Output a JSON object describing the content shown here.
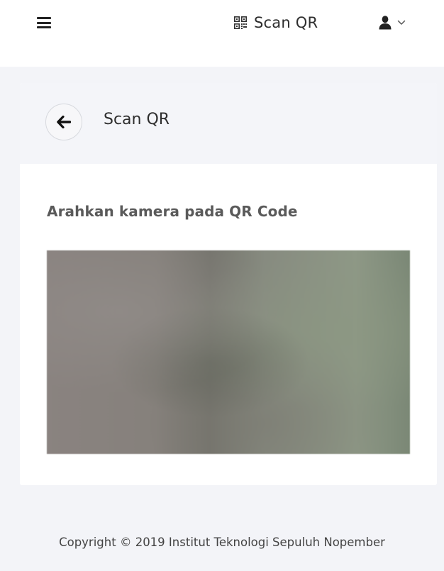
{
  "navbar": {
    "menu_icon": "hamburger-menu-icon",
    "title_icon": "qr-code-icon",
    "title": "Scan QR",
    "user_icon": "user-icon",
    "user_chevron_icon": "chevron-down-icon"
  },
  "card": {
    "back_icon": "arrow-left-icon",
    "title": "Scan QR",
    "instruction": "Arahkan kamera pada QR Code"
  },
  "footer": {
    "copyright": "Copyright © 2019 Institut Teknologi Sepuluh Nopember"
  }
}
